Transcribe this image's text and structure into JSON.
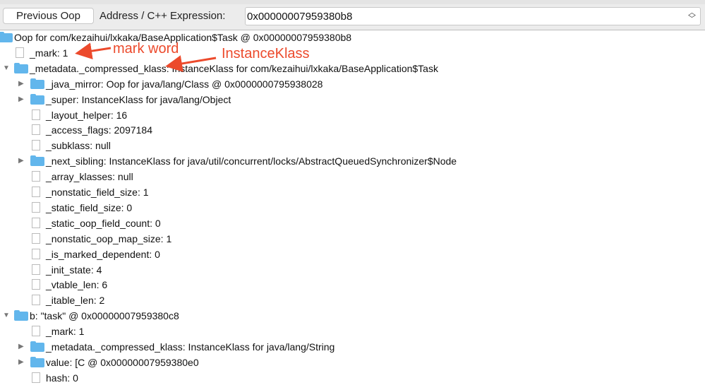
{
  "toolbar": {
    "previous_oop": "Previous Oop",
    "address_label": "Address / C++ Expression:",
    "address_value": "0x00000007959380b8"
  },
  "tree": [
    {
      "level": 0,
      "type": "folder",
      "expanded": null,
      "text": "Oop for com/kezaihui/lxkaka/BaseApplication$Task @ 0x00000007959380b8"
    },
    {
      "level": 1,
      "type": "file",
      "text": "_mark: 1"
    },
    {
      "level": 1,
      "type": "folder",
      "expanded": true,
      "text": "_metadata._compressed_klass: InstanceKlass for com/kezaihui/lxkaka/BaseApplication$Task"
    },
    {
      "level": 2,
      "type": "folder",
      "expanded": false,
      "text": "_java_mirror: Oop for java/lang/Class @ 0x0000000795938028"
    },
    {
      "level": 2,
      "type": "folder",
      "expanded": false,
      "text": "_super: InstanceKlass for java/lang/Object"
    },
    {
      "level": 2,
      "type": "file",
      "text": "_layout_helper: 16"
    },
    {
      "level": 2,
      "type": "file",
      "text": "_access_flags: 2097184"
    },
    {
      "level": 2,
      "type": "file",
      "text": "_subklass: null"
    },
    {
      "level": 2,
      "type": "folder",
      "expanded": false,
      "text": "_next_sibling: InstanceKlass for java/util/concurrent/locks/AbstractQueuedSynchronizer$Node"
    },
    {
      "level": 2,
      "type": "file",
      "text": "_array_klasses: null"
    },
    {
      "level": 2,
      "type": "file",
      "text": "_nonstatic_field_size: 1"
    },
    {
      "level": 2,
      "type": "file",
      "text": "_static_field_size: 0"
    },
    {
      "level": 2,
      "type": "file",
      "text": "_static_oop_field_count: 0"
    },
    {
      "level": 2,
      "type": "file",
      "text": "_nonstatic_oop_map_size: 1"
    },
    {
      "level": 2,
      "type": "file",
      "text": "_is_marked_dependent: 0"
    },
    {
      "level": 2,
      "type": "file",
      "text": "_init_state: 4"
    },
    {
      "level": 2,
      "type": "file",
      "text": "_vtable_len: 6"
    },
    {
      "level": 2,
      "type": "file",
      "text": "_itable_len: 2"
    },
    {
      "level": 1,
      "type": "folder",
      "expanded": true,
      "text": "b: \"task\" @ 0x00000007959380c8"
    },
    {
      "level": 2,
      "type": "file",
      "text": "_mark: 1"
    },
    {
      "level": 2,
      "type": "folder",
      "expanded": false,
      "text": "_metadata._compressed_klass: InstanceKlass for java/lang/String"
    },
    {
      "level": 2,
      "type": "folder",
      "expanded": false,
      "text": "value: [C @ 0x00000007959380e0"
    },
    {
      "level": 2,
      "type": "file",
      "text": "hash: 0"
    }
  ],
  "annotations": {
    "mark_word": "mark word",
    "instance_klass": "InstanceKlass",
    "color": "#ec4a2c"
  }
}
